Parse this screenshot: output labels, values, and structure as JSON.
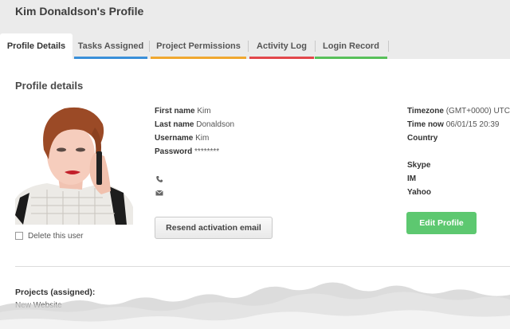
{
  "header": {
    "title": "Kim Donaldson's Profile"
  },
  "tabs": [
    {
      "label": "Profile Details",
      "color": "",
      "active": true
    },
    {
      "label": "Tasks Assigned",
      "color": "#3a8fd9"
    },
    {
      "label": "Project Permissions",
      "color": "#f0a830"
    },
    {
      "label": "Activity Log",
      "color": "#e2474b"
    },
    {
      "label": "Login Record",
      "color": "#58c05a"
    }
  ],
  "section": {
    "title": "Profile details"
  },
  "delete_user": {
    "label": "Delete this user",
    "checked": false
  },
  "profile": {
    "first_name": {
      "label": "First name",
      "value": "Kim"
    },
    "last_name": {
      "label": "Last name",
      "value": "Donaldson"
    },
    "username": {
      "label": "Username",
      "value": "Kim"
    },
    "password": {
      "label": "Password",
      "value": "********"
    }
  },
  "contact_icons": [
    "phone-icon",
    "envelope-icon"
  ],
  "meta": {
    "timezone": {
      "label": "Timezone",
      "value": "(GMT+0000) UTC"
    },
    "time_now": {
      "label": "Time now",
      "value": "06/01/15 20:39"
    },
    "country": {
      "label": "Country",
      "value": ""
    },
    "skype": {
      "label": "Skype",
      "value": ""
    },
    "im": {
      "label": "IM",
      "value": ""
    },
    "yahoo": {
      "label": "Yahoo",
      "value": ""
    }
  },
  "actions": {
    "resend_label": "Resend activation email",
    "edit_label": "Edit Profile",
    "edit_color": "#5dc870"
  },
  "projects": {
    "title": "Projects (assigned):",
    "items": [
      "New Website"
    ]
  }
}
